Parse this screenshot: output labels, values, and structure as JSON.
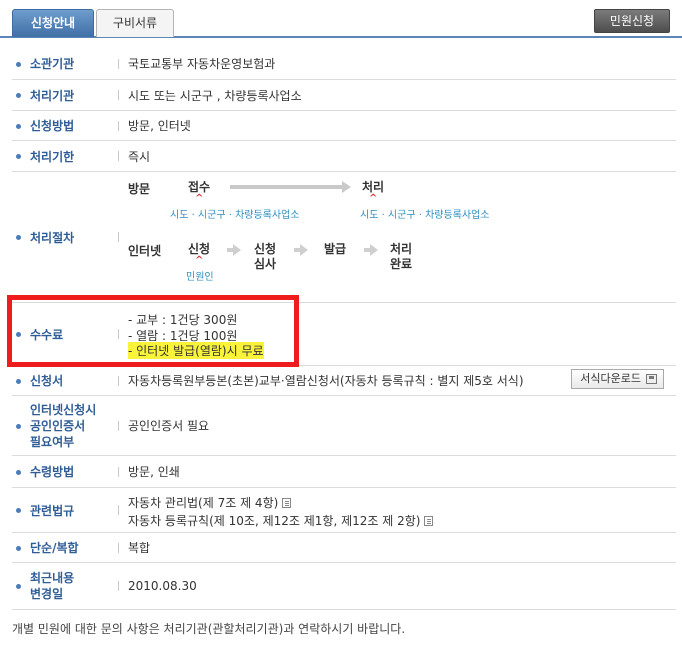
{
  "tabs": {
    "active": "신청안내",
    "inactive": "구비서류"
  },
  "apply_button": "민원신청",
  "rows": {
    "agency": {
      "label": "소관기관",
      "value": "국토교통부 자동차운영보험과"
    },
    "handler": {
      "label": "처리기관",
      "value": "시도 또는 시군구 , 차량등록사업소"
    },
    "method": {
      "label": "신청방법",
      "value": "방문, 인터넷"
    },
    "deadline": {
      "label": "처리기한",
      "value": "즉시"
    },
    "procedure": {
      "label": "처리절차",
      "visit": {
        "title": "방문",
        "step1": "접수",
        "step1_sub": "시도 · 시군구 · 차량등록사업소",
        "step2": "처리",
        "step2_sub": "시도 · 시군구 · 차량등록사업소"
      },
      "internet": {
        "title": "인터넷",
        "step1": "신청",
        "step1_sub": "민원인",
        "step2_line1": "신청",
        "step2_line2": "심사",
        "step3": "발급",
        "step4_line1": "처리",
        "step4_line2": "완료"
      }
    },
    "fee": {
      "label": "수수료",
      "line1": "- 교부 : 1건당 300원",
      "line2": "- 열람 : 1건당 100원",
      "line3": "- 인터넷 발급(열람)시 무료"
    },
    "form": {
      "label": "신청서",
      "value": "자동차등록원부등본(초본)교부·열람신청서(자동차 등록규칙 : 별지 제5호 서식)",
      "download": "서식다운로드"
    },
    "cert": {
      "label_line1": "인터넷신청시",
      "label_line2": "공인인증서",
      "label_line3": "필요여부",
      "value": "공인인증서 필요"
    },
    "receive": {
      "label": "수령방법",
      "value": "방문, 인쇄"
    },
    "laws": {
      "label": "관련법규",
      "line1": "자동차 관리법(제 7조 제 4항)",
      "line2": "자동차 등록규칙(제 10조, 제12조 제1항, 제12조 제 2항)"
    },
    "type": {
      "label": "단순/복합",
      "value": "복합"
    },
    "updated": {
      "label_line1": "최근내용",
      "label_line2": "변경일",
      "value": "2010.08.30"
    }
  },
  "footer": "개별 민원에 대한 문의 사항은 처리기관(관할처리기관)과 연락하시기 바랍니다.",
  "colors": {
    "label": "#2f5d96",
    "accent": "#ee1c1c",
    "highlight": "#f9f33a",
    "sub": "#2f8ec0"
  }
}
